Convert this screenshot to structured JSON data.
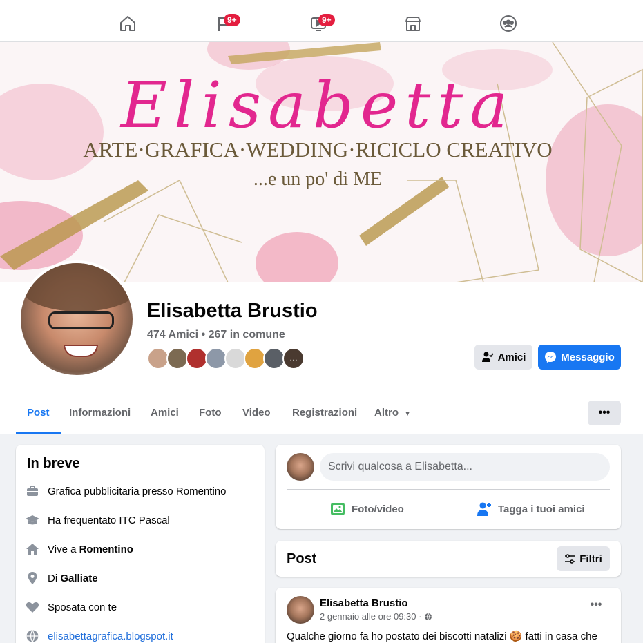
{
  "nav": {
    "items": [
      {
        "icon": "home-icon"
      },
      {
        "icon": "flag-pages-icon",
        "badge": "9+"
      },
      {
        "icon": "watch-video-icon",
        "badge": "9+"
      },
      {
        "icon": "marketplace-icon"
      },
      {
        "icon": "groups-icon"
      }
    ]
  },
  "cover": {
    "title": "Elisabetta",
    "subtitle": "ARTE·GRAFICA·WEDDING·RICICLO CREATIVO",
    "tagline": "...e un po' di ME"
  },
  "profile": {
    "name": "Elisabetta Brustio",
    "friends_summary": "474 Amici • 267 in comune"
  },
  "actions": {
    "friends_label": "Amici",
    "message_label": "Messaggio"
  },
  "tabs": [
    {
      "label": "Post"
    },
    {
      "label": "Informazioni"
    },
    {
      "label": "Amici"
    },
    {
      "label": "Foto"
    },
    {
      "label": "Video"
    },
    {
      "label": "Registrazioni"
    },
    {
      "label": "Altro"
    }
  ],
  "more_label": "•••",
  "intro": {
    "title": "In breve",
    "items": [
      {
        "icon": "briefcase-icon",
        "text": "Grafica pubblicitaria presso Romentino"
      },
      {
        "icon": "graduation-cap-icon",
        "text": "Ha frequentato ITC Pascal"
      },
      {
        "icon": "house-icon",
        "prefix": "Vive a ",
        "bold": "Romentino"
      },
      {
        "icon": "location-pin-icon",
        "prefix": "Di ",
        "bold": "Galliate"
      },
      {
        "icon": "heart-icon",
        "text": "Sposata con te"
      },
      {
        "icon": "globe-icon",
        "text": "elisabettagrafica.blogspot.it"
      }
    ]
  },
  "composer": {
    "placeholder": "Scrivi qualcosa a Elisabetta...",
    "photo_label": "Foto/video",
    "tag_label": "Tagga i tuoi amici"
  },
  "posts_header": {
    "title": "Post",
    "filter_label": "Filtri"
  },
  "post": {
    "author": "Elisabetta Brustio",
    "time": "2 gennaio alle ore 09:30 ·",
    "more": "•••",
    "text_before": "Qualche giorno fa ho postato dei biscotti natalizi ",
    "emoji": "🍪",
    "text_after": " fatti in casa che"
  },
  "colors": {
    "accent": "#1877f2",
    "badge": "#e41e3f",
    "cover_pink": "#e2278f",
    "cover_gold": "#6b5a3a"
  }
}
